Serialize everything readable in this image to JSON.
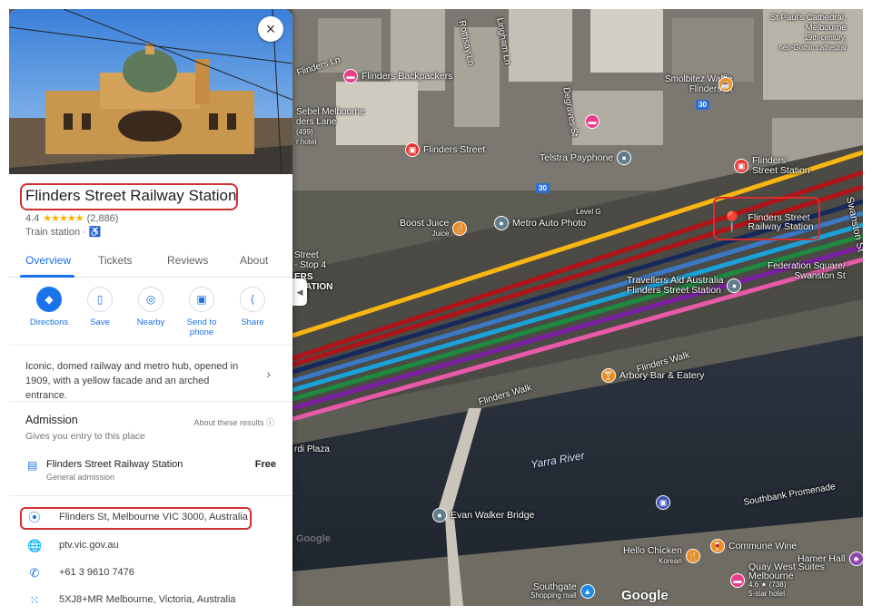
{
  "place": {
    "name": "Flinders Street Railway Station",
    "rating": "4.4",
    "stars": "★★★★★",
    "reviews_count": "(2,886)",
    "type": "Train station ·",
    "close_icon": "×"
  },
  "tabs": [
    {
      "label": "Overview"
    },
    {
      "label": "Tickets"
    },
    {
      "label": "Reviews"
    },
    {
      "label": "About"
    }
  ],
  "actions": [
    {
      "label": "Directions",
      "icon": "◆"
    },
    {
      "label": "Save",
      "icon": "▯"
    },
    {
      "label": "Nearby",
      "icon": "◎"
    },
    {
      "label": "Send to phone",
      "icon": "▣"
    },
    {
      "label": "Share",
      "icon": "⟨"
    }
  ],
  "description": "Iconic, domed railway and metro hub, opened in 1909, with a yellow facade and an arched entrance.",
  "admission": {
    "title": "Admission",
    "subtitle": "Gives you entry to this place",
    "about_results": "About these results ⓘ",
    "ticket_name": "Flinders Street Railway Station",
    "ticket_sub": "General admission",
    "price": "Free"
  },
  "info": {
    "address": "Flinders St, Melbourne VIC 3000, Australia",
    "website": "ptv.vic.gov.au",
    "phone": "+61 3 9610 7476",
    "plus_code": "5XJ8+MR Melbourne, Victoria, Australia"
  },
  "map": {
    "pois": {
      "flinders_backpackers": "Flinders Backpackers",
      "smolbitez": "Smolbitez Waffle",
      "smolbitez2": "Flinders St",
      "sebel1": "Sebel Melbourne",
      "sebel2": "ders Lane",
      "sebel3": "(499)",
      "sebel4": "r hotel",
      "flinders_street": "Flinders Street",
      "telstra": "Telstra Payphone",
      "flinders_station1": "Flinders",
      "flinders_station2": "Street Station",
      "selected1": "Flinders Street",
      "selected2": "Railway Station",
      "boost1": "Boost Juice",
      "boost2": "Juice",
      "metro_auto": "Metro Auto Photo",
      "level_g": "Level G",
      "federation1": "Federation Square/",
      "federation2": "Swanston St",
      "travellers1": "Travellers Aid Australia",
      "travellers2": "Flinders Street Station",
      "arbory": "Arbory Bar & Eatery",
      "evan_walker": "Evan Walker Bridge",
      "hello_chicken1": "Hello Chicken",
      "hello_chicken2": "Korean",
      "commune": "Commune Wine",
      "quay1": "Quay West Suites",
      "quay2": "Melbourne",
      "quay3": "4.6 ★ (738)",
      "quay4": "5-star hotel",
      "hamer": "Hamer Hall",
      "southgate1": "Southgate",
      "southgate2": "Shopping mall",
      "stpauls1": "St Paul's Cathedral,",
      "stpauls2": "Melbourne",
      "stpauls3": "19th-century,",
      "stpauls4": "neo-Gothic cathedral",
      "street_stop1": "Street",
      "street_stop2": "- Stop 4",
      "station_left1": "ERS",
      "station_left2": "STATION"
    },
    "streets": {
      "flinders_ln": "Flinders Ln",
      "rothsay": "Rothsay Ln",
      "lingham": "Lingham Ln",
      "degraves": "Degraves St",
      "swanston": "Swanston St",
      "flinders_walk1": "Flinders Walk",
      "flinders_walk2": "Flinders Walk",
      "southbank": "Southbank Promenade",
      "plaza": "rdi Plaza",
      "route30a": "30",
      "route30b": "30"
    },
    "river": "Yarra River",
    "google": "Google",
    "google_faint": "Google",
    "collapse_icon": "◀"
  },
  "colors": {
    "accent": "#1a73e8",
    "highlight": "#d32f2f",
    "star": "#f4b400"
  }
}
